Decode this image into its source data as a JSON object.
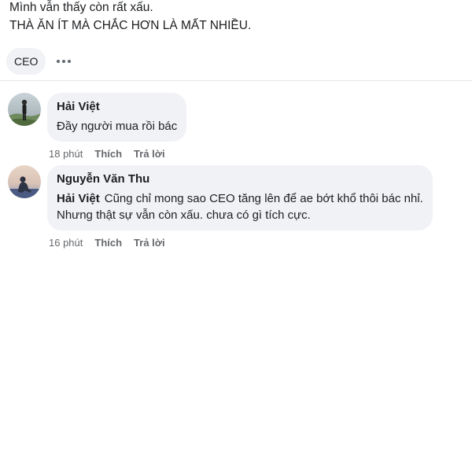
{
  "post": {
    "line1": "Mình vẫn thấy còn rất xấu.",
    "line2": "THÀ ĂN ÍT MÀ CHẮC HƠN LÀ MẤT NHIỀU."
  },
  "reaction_bar": {
    "tag_label": "CEO",
    "more_icon": "more-horizontal-icon"
  },
  "comments": [
    {
      "author": "Hải Việt",
      "text": "Đầy người mua rồi bác",
      "time": "18 phút",
      "like_label": "Thích",
      "reply_label": "Trả lời",
      "avatar_icon": "person-avatar"
    },
    {
      "author": "Nguyễn Văn Thu",
      "mention": "Hải Việt",
      "text_line1": "Cũng chỉ mong sao CEO tăng lên để ae bớt khổ thôi bác nhỉ.",
      "text_line2": "Nhưng thật sự vẫn còn xấu. chưa có gì tích cực.",
      "time": "16 phút",
      "like_label": "Thích",
      "reply_label": "Trả lời",
      "avatar_icon": "person-avatar"
    }
  ],
  "colors": {
    "bubble": "#f0f2f5",
    "meta_text": "#65676b",
    "divider": "#e4e6eb"
  }
}
